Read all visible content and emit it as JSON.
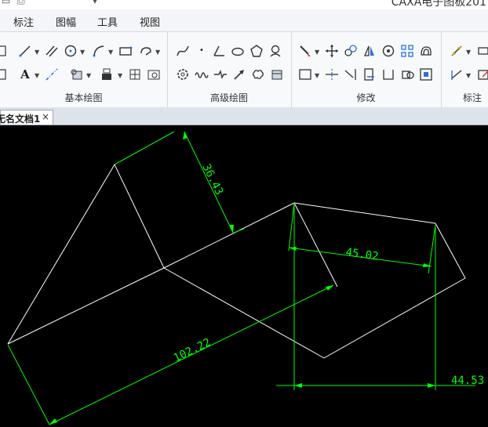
{
  "app": {
    "title": "CAXA电子图板201"
  },
  "menu": {
    "items": [
      "标注",
      "图幅",
      "工具",
      "视图"
    ]
  },
  "ribbon": {
    "groups": [
      {
        "label": "基本绘图"
      },
      {
        "label": "高级绘图"
      },
      {
        "label": "修改"
      },
      {
        "label": "标注"
      }
    ]
  },
  "document": {
    "tab_label": "无名文档1",
    "close_glyph": "×"
  },
  "drawing": {
    "line_color": "#ffffff",
    "dimension_color": "#00ff00",
    "background": "#000000",
    "dimensions": [
      "36.43",
      "102.22",
      "45.02",
      "44.53"
    ]
  },
  "icons": [
    "line-icon",
    "parallel-icon",
    "circle-icon",
    "arc-icon",
    "rectangle-icon",
    "polyline-icon",
    "text-icon",
    "centerline-icon",
    "hatch-icon",
    "spline-icon",
    "point-icon",
    "polygon-icon",
    "move-icon",
    "mirror-icon"
  ]
}
